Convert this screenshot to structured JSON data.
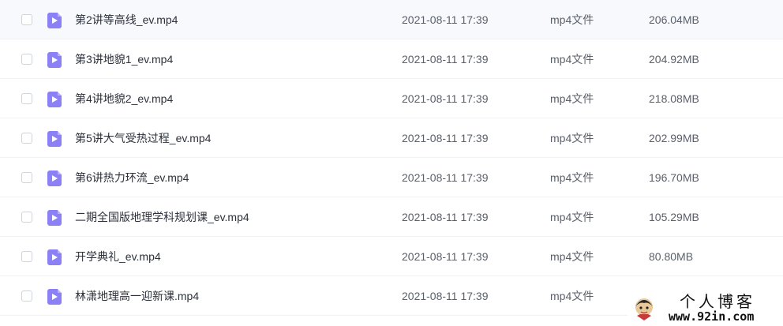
{
  "files": [
    {
      "name": "第2讲等高线_ev.mp4",
      "date": "2021-08-11 17:39",
      "type": "mp4文件",
      "size": "206.04MB"
    },
    {
      "name": "第3讲地貌1_ev.mp4",
      "date": "2021-08-11 17:39",
      "type": "mp4文件",
      "size": "204.92MB"
    },
    {
      "name": "第4讲地貌2_ev.mp4",
      "date": "2021-08-11 17:39",
      "type": "mp4文件",
      "size": "218.08MB"
    },
    {
      "name": "第5讲大气受热过程_ev.mp4",
      "date": "2021-08-11 17:39",
      "type": "mp4文件",
      "size": "202.99MB"
    },
    {
      "name": "第6讲热力环流_ev.mp4",
      "date": "2021-08-11 17:39",
      "type": "mp4文件",
      "size": "196.70MB"
    },
    {
      "name": "二期全国版地理学科规划课_ev.mp4",
      "date": "2021-08-11 17:39",
      "type": "mp4文件",
      "size": "105.29MB"
    },
    {
      "name": "开学典礼_ev.mp4",
      "date": "2021-08-11 17:39",
      "type": "mp4文件",
      "size": "80.80MB"
    },
    {
      "name": "林潇地理高一迎新课.mp4",
      "date": "2021-08-11 17:39",
      "type": "mp4文件",
      "size": ""
    }
  ],
  "watermark": {
    "title": "个人博客",
    "url": "www.92in.com"
  },
  "colors": {
    "video_icon": "#8b80f5",
    "text_primary": "#2b303a",
    "text_secondary": "#5a606b"
  }
}
